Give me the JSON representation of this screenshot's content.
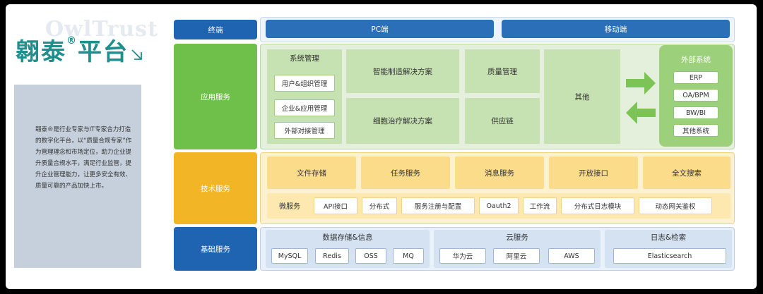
{
  "brand": {
    "watermark": "OwlTrust",
    "name": "翱泰",
    "reg": "®",
    "suffix": "平台"
  },
  "intro_text": "翱泰®是行业专家与IT专家合力打造的数字化平台，以“质量合规专家”作为管理理念和市场定位，助力企业提升质量合规水平，满足行业监管，提升企业管理能力，让更多安全有效、质量可靠的产品加快上市。",
  "colors": {
    "primary_blue": "#1f64b0",
    "green": "#6fc04a",
    "yellow": "#f2b525",
    "brand_teal": "#1e8f8d"
  },
  "terminal": {
    "label": "终端",
    "pc": "PC端",
    "mobile": "移动端"
  },
  "app_service": {
    "label": "应用服务",
    "system_mgmt": {
      "title": "系统管理",
      "items": [
        "用户&组织管理",
        "企业&应用管理",
        "外部对接管理"
      ]
    },
    "modules": [
      "智能制造解决方案",
      "质量管理",
      "细胞治疗解决方案",
      "供应链"
    ],
    "other": "其他"
  },
  "external": {
    "title": "外部系统",
    "items": [
      "ERP",
      "OA/BPM",
      "BW/BI",
      "其他系统"
    ]
  },
  "tech_service": {
    "label": "技术服务",
    "top": [
      "文件存储",
      "任务服务",
      "消息服务",
      "开放接口",
      "全文搜索"
    ],
    "micro_label": "微服务",
    "micro": [
      "API接口",
      "分布式",
      "服务注册与配置",
      "Oauth2",
      "工作流",
      "分布式日志模块",
      "动态网关鉴权"
    ]
  },
  "base_service": {
    "label": "基础服务",
    "groups": [
      {
        "title": "数据存储&信息",
        "items": [
          "MySQL",
          "Redis",
          "OSS",
          "MQ"
        ]
      },
      {
        "title": "云服务",
        "items": [
          "华为云",
          "阿里云",
          "AWS"
        ]
      },
      {
        "title": "日志&检索",
        "items": [
          "Elasticsearch"
        ]
      }
    ]
  }
}
